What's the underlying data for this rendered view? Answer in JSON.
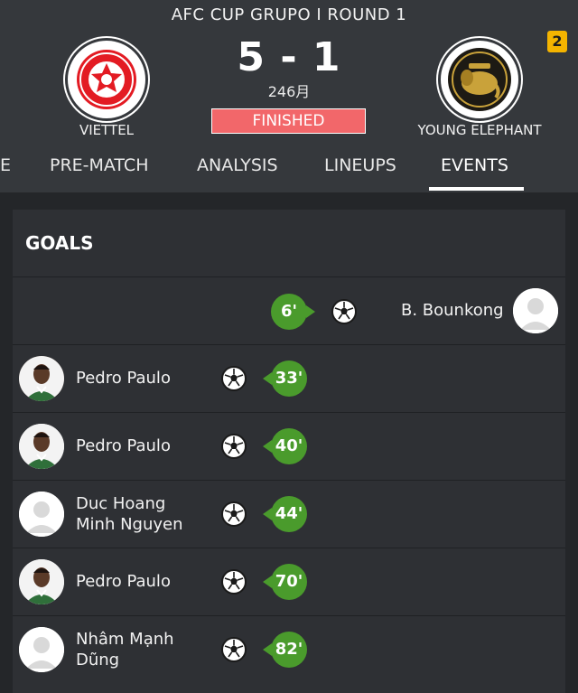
{
  "match": {
    "competition": "AFC CUP  GRUPO I ROUND 1",
    "score": "5 - 1",
    "subscore": "246月",
    "status": "FINISHED",
    "badge_count": "2",
    "home_team": "VIETTEL",
    "away_team": "YOUNG ELEPHANT"
  },
  "tabs": [
    {
      "label": "E"
    },
    {
      "label": "PRE-MATCH"
    },
    {
      "label": "ANALYSIS"
    },
    {
      "label": "LINEUPS"
    },
    {
      "label": "EVENTS",
      "active": true
    }
  ],
  "goals": {
    "title": "GOALS",
    "events": [
      {
        "side": "away",
        "player": "B. Bounkong",
        "minute": "6'",
        "avatar": "placeholder"
      },
      {
        "side": "home",
        "player": "Pedro Paulo",
        "minute": "33'",
        "avatar": "photo"
      },
      {
        "side": "home",
        "player": "Pedro Paulo",
        "minute": "40'",
        "avatar": "photo"
      },
      {
        "side": "home",
        "player_line1": "Duc Hoang",
        "player_line2": "Minh Nguyen",
        "minute": "44'",
        "avatar": "placeholder"
      },
      {
        "side": "home",
        "player": "Pedro Paulo",
        "minute": "70'",
        "avatar": "photo"
      },
      {
        "side": "home",
        "player_line1": "Nhâm Mạnh",
        "player_line2": "Dũng",
        "minute": "82'",
        "avatar": "placeholder"
      }
    ]
  },
  "colors": {
    "background": "#242629",
    "header": "#35383c",
    "panel": "#2e3034",
    "status_red": "#f2676a",
    "goal_green": "#4a9b2c",
    "badge_yellow": "#f4b400"
  }
}
